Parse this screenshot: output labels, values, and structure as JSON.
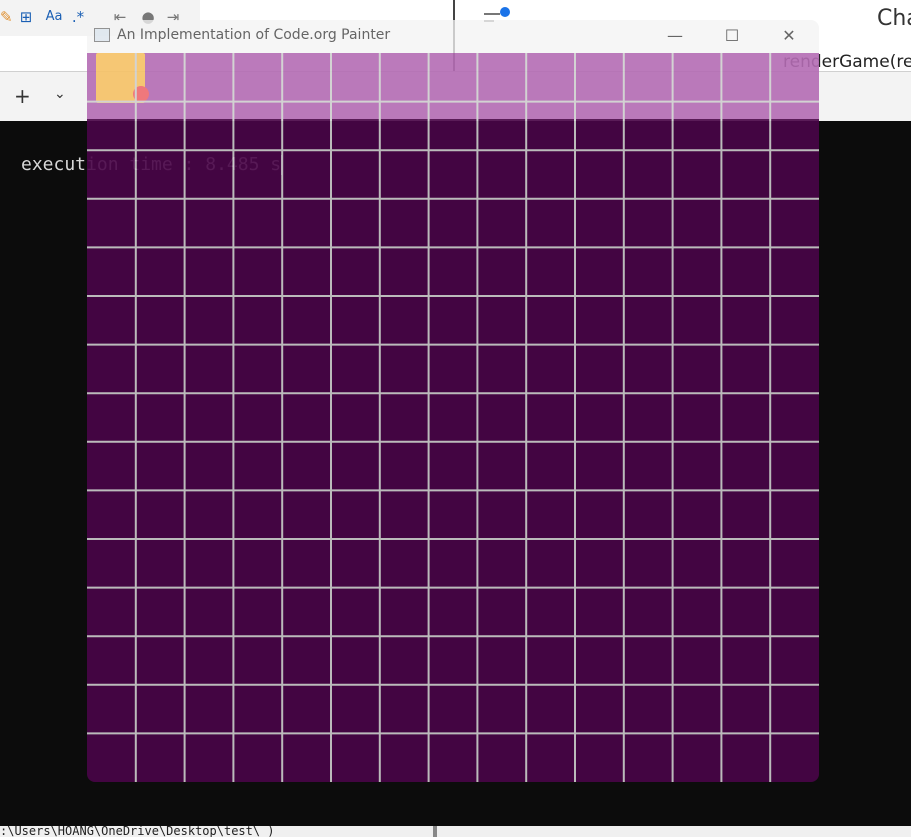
{
  "editor": {
    "find_toolbar": {
      "buttons": [
        {
          "name": "match-case-icon",
          "glyph": "Aa"
        },
        {
          "name": "regex-icon",
          "glyph": ".*"
        }
      ]
    },
    "right_pane": {
      "chat_label": "Cha",
      "code_snippet": "renderGame(re"
    },
    "tabs": {
      "add_label": "+",
      "dropdown_label": "⌄"
    }
  },
  "console": {
    "output_line": "execution time : 8.485 s",
    "path_line": ":\\Users\\HOANG\\OneDrive\\Desktop\\test\\ )"
  },
  "painter": {
    "title": "An Implementation of Code.org Painter",
    "controls": {
      "minimize": "—",
      "maximize": "☐",
      "close": "✕"
    },
    "grid": {
      "columns": 15,
      "rows": 15,
      "cell_color": "#4a0548",
      "line_color": "#cfcfcf",
      "highlight_color": "#b46cb4"
    },
    "cursor": {
      "row": 0,
      "column": 0,
      "cell_color": "#f6c266",
      "marker_color": "#ef6b70"
    }
  }
}
